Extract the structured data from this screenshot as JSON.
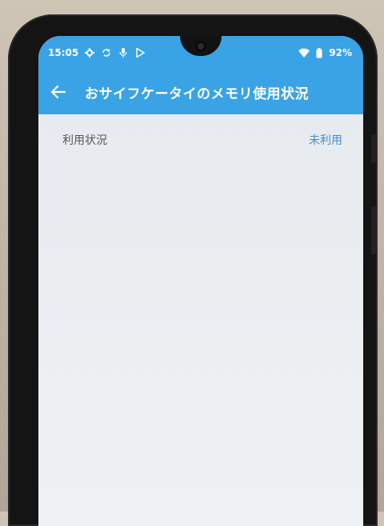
{
  "status_bar": {
    "time": "15:05",
    "battery": "92%",
    "icons": [
      "gear-icon",
      "sync-icon",
      "mic-icon",
      "play-store-icon",
      "wifi-icon",
      "battery-icon"
    ]
  },
  "toolbar": {
    "back_icon": "arrow-left-icon",
    "title": "おサイフケータイのメモリ使用状況"
  },
  "settings": {
    "rows": [
      {
        "label": "利用状況",
        "value": "未利用"
      }
    ]
  },
  "colors": {
    "accent": "#3aa3e6",
    "link": "#3d8fd0",
    "background": "#e9eef2"
  }
}
